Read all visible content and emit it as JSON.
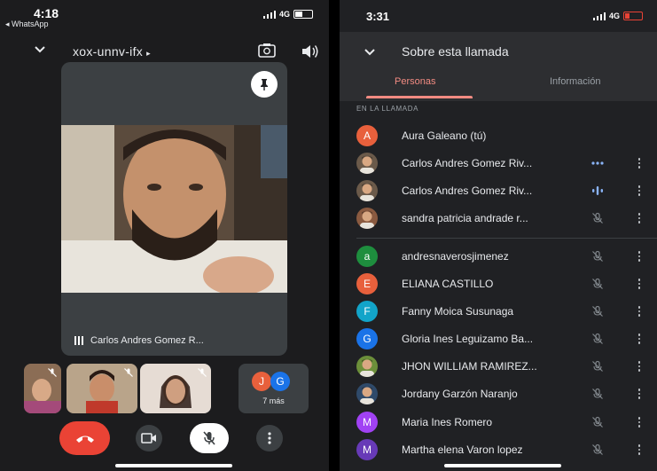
{
  "left": {
    "status": {
      "time": "4:18",
      "back_app": "◂ WhatsApp",
      "network": "4G"
    },
    "meeting_code": "xox-unnv-ifx",
    "main_tile_name": "Carlos Andres Gomez R...",
    "more_tile": {
      "avatars": [
        {
          "letter": "J",
          "color": "#e8603c"
        },
        {
          "letter": "G",
          "color": "#1a73e8"
        }
      ],
      "label": "7 más"
    },
    "controls": {
      "hangup": "phone-hangup",
      "camera": "video-camera",
      "mic": "mic-off",
      "more": "more-vertical"
    }
  },
  "right": {
    "status": {
      "time": "3:31",
      "network": "4G"
    },
    "title": "Sobre esta llamada",
    "tabs": [
      "Personas",
      "Información"
    ],
    "section_label": "EN LA LLAMADA",
    "participants": [
      {
        "name": "Aura Galeano (tú)",
        "avatar": "A",
        "color": "#e8603c",
        "status": "none",
        "menu": false
      },
      {
        "name": "Carlos Andres Gomez Riv...",
        "avatar": "photo",
        "color": "#6b5a4a",
        "status": "speaking-dots",
        "menu": true
      },
      {
        "name": "Carlos Andres Gomez Riv...",
        "avatar": "photo",
        "color": "#6b5a4a",
        "status": "speaking-bars",
        "menu": true
      },
      {
        "name": "sandra patricia andrade r...",
        "avatar": "photo",
        "color": "#8a5a40",
        "status": "muted",
        "menu": true
      },
      {
        "name": "andresnaverosjimenez",
        "avatar": "a",
        "color": "#1e8e3e",
        "status": "muted",
        "menu": true
      },
      {
        "name": "ELIANA CASTILLO",
        "avatar": "E",
        "color": "#e8603c",
        "status": "muted",
        "menu": true
      },
      {
        "name": "Fanny Moica Susunaga",
        "avatar": "F",
        "color": "#12a4c9",
        "status": "muted",
        "menu": true
      },
      {
        "name": "Gloria Ines Leguizamo Ba...",
        "avatar": "G",
        "color": "#1a73e8",
        "status": "muted",
        "menu": true
      },
      {
        "name": "JHON WILLIAM RAMIREZ...",
        "avatar": "photo",
        "color": "#6c8f3a",
        "status": "muted",
        "menu": true
      },
      {
        "name": "Jordany Garzón Naranjo",
        "avatar": "photo",
        "color": "#2f4a6a",
        "status": "muted",
        "menu": true
      },
      {
        "name": "Maria Ines Romero",
        "avatar": "M",
        "color": "#a142f4",
        "status": "muted",
        "menu": true
      },
      {
        "name": "Martha elena Varon lopez",
        "avatar": "M",
        "color": "#673ab7",
        "status": "muted",
        "menu": true
      }
    ]
  },
  "colors": {
    "accent_red": "#ea4335",
    "tab_active": "#f28b82",
    "speaking_blue": "#8ab4f8"
  }
}
